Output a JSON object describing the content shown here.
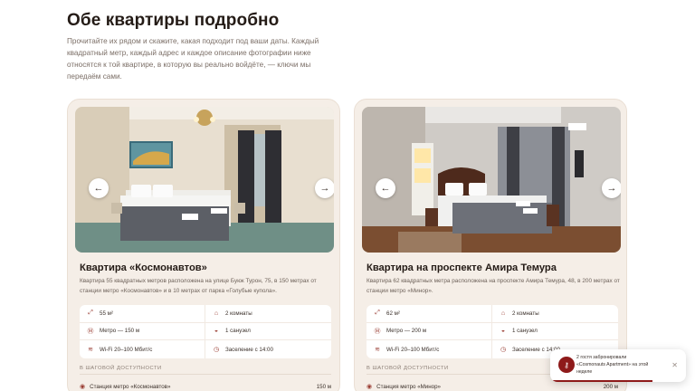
{
  "section": {
    "heading": "Обе квартиры подробно",
    "intro": "Прочитайте их рядом и скажите, какая подходит под ваши даты. Каждый квадратный метр, каждый адрес и каждое описание фотографии ниже относятся к той квартире, в которую вы реально войдёте, — ключи мы передаём сами."
  },
  "colors": {
    "accent": "#9a3d33",
    "brand_dark": "#8e1a1a",
    "card_bg": "#f5eee7"
  },
  "cards": [
    {
      "title": "Квартира «Космонавтов»",
      "description": "Квартира 55 квадратных метров расположена на улице Буюк Турон, 75, в 150 метрах от станции метро «Космонавтов» и в 10 метрах от парка «Голубые купола».",
      "prev_icon": "arrow-left-icon",
      "next_icon": "arrow-right-icon",
      "features": [
        {
          "icon": "area-icon",
          "label": "55 м²"
        },
        {
          "icon": "bed-icon",
          "label": "2 комнаты"
        },
        {
          "icon": "metro-icon",
          "label": "Метро — 150 м"
        },
        {
          "icon": "bath-icon",
          "label": "1 санузел"
        },
        {
          "icon": "wifi-icon",
          "label": "Wi-Fi 20–100 Мбит/с"
        },
        {
          "icon": "clock-icon",
          "label": "Заселение с 14:00"
        }
      ],
      "walk_label": "В ШАГОВОЙ ДОСТУПНОСТИ",
      "walk_item": {
        "name": "Станция метро «Космонавтов»",
        "distance": "150 м"
      }
    },
    {
      "title": "Квартира на проспекте Амира Темура",
      "description": "Квартира 62 квадратных метра расположена на проспекте Амира Темура, 48, в 200 метрах от станции метро «Минор».",
      "prev_icon": "arrow-left-icon",
      "next_icon": "arrow-right-icon",
      "features": [
        {
          "icon": "area-icon",
          "label": "62 м²"
        },
        {
          "icon": "bed-icon",
          "label": "2 комнаты"
        },
        {
          "icon": "metro-icon",
          "label": "Метро — 200 м"
        },
        {
          "icon": "bath-icon",
          "label": "1 санузел"
        },
        {
          "icon": "wifi-icon",
          "label": "Wi-Fi 20–100 Мбит/с"
        },
        {
          "icon": "clock-icon",
          "label": "Заселение с 14:00"
        }
      ],
      "walk_label": "В ШАГОВОЙ ДОСТУПНОСТИ",
      "walk_item": {
        "name": "Станция метро «Минор»",
        "distance": "200 м"
      }
    }
  ],
  "toast": {
    "message": "2 гостя забронировали «Cosmonauts Apartment» на этой неделе",
    "icon": "key-icon",
    "close_icon": "close-icon",
    "progress": 0.75
  }
}
